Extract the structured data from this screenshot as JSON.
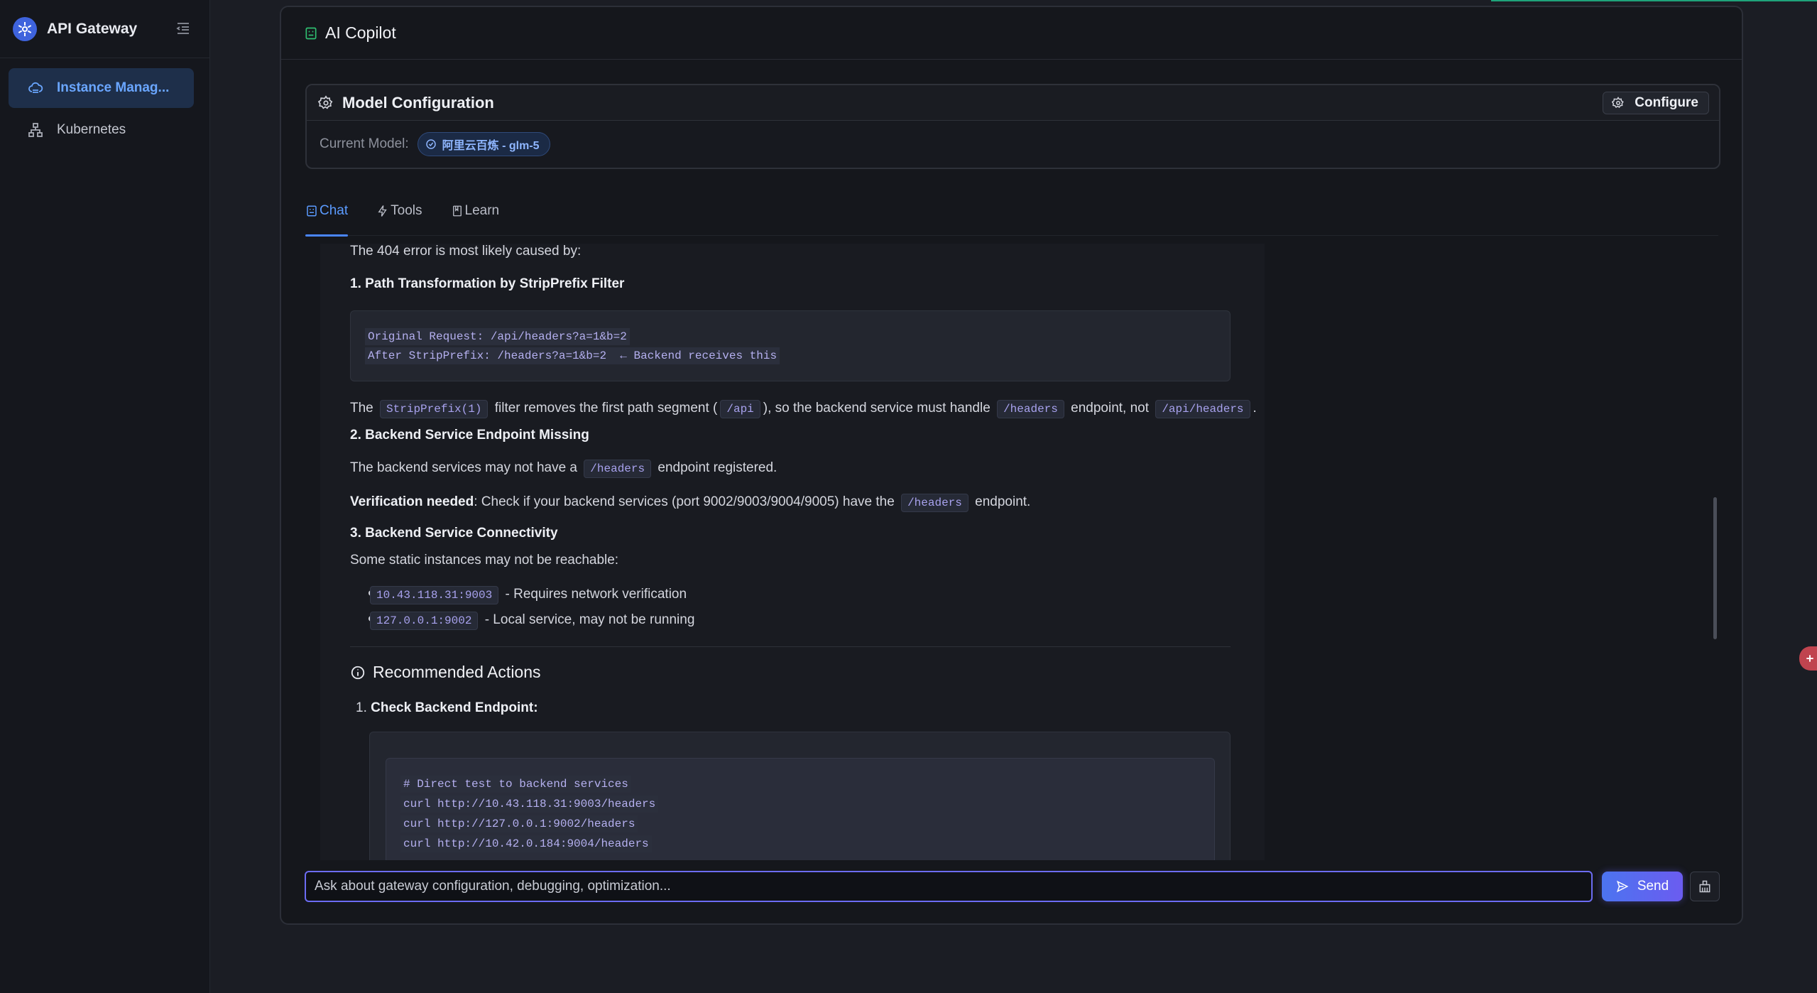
{
  "app": {
    "name": "API Gateway"
  },
  "sidebar": {
    "items": [
      {
        "label": "Instance Manag...",
        "icon": "cloud-gateway-icon",
        "active": true
      },
      {
        "label": "Kubernetes",
        "icon": "cluster-icon",
        "active": false
      }
    ]
  },
  "panel": {
    "title": "AI Copilot",
    "model_config": {
      "title": "Model Configuration",
      "configure_label": "Configure",
      "current_model_label": "Current Model:",
      "current_model_value": "阿里云百炼 - glm-5"
    },
    "tabs": [
      {
        "label": "Chat",
        "icon": "chat-icon",
        "active": true
      },
      {
        "label": "Tools",
        "icon": "lightning-icon",
        "active": false
      },
      {
        "label": "Learn",
        "icon": "book-icon",
        "active": false
      }
    ]
  },
  "message": {
    "intro": "The 404 error is most likely caused by:",
    "h1": "1. Path Transformation by StripPrefix Filter",
    "code1": [
      "Original Request: /api/headers?a=1&b=2",
      "After StripPrefix: /headers?a=1&b=2  ← Backend receives this"
    ],
    "p1_a": "The",
    "p1_code1": "StripPrefix(1)",
    "p1_b": "filter removes the first path segment (",
    "p1_code2": "/api",
    "p1_c": "), so the backend service must handle",
    "p1_code3": "/headers",
    "p1_d": "endpoint, not",
    "p1_code4": "/api/headers",
    "p1_e": ".",
    "h2": "2. Backend Service Endpoint Missing",
    "p2_a": "The backend services may not have a",
    "p2_code": "/headers",
    "p2_b": "endpoint registered.",
    "p3_bold": "Verification needed",
    "p3_a": ": Check if your backend services (port 9002/9003/9004/9005) have the",
    "p3_code": "/headers",
    "p3_b": "endpoint.",
    "h3": "3. Backend Service Connectivity",
    "p4": "Some static instances may not be reachable:",
    "li1_code": "10.43.118.31:9003",
    "li1_text": "- Requires network verification",
    "li2_code": "127.0.0.1:9002",
    "li2_text": "- Local service, may not be running",
    "section_title": "Recommended Actions",
    "step1_num": "1.",
    "step1": "Check Backend Endpoint:",
    "code2": [
      "# Direct test to backend services",
      "curl http://10.43.118.31:9003/headers",
      "curl http://127.0.0.1:9002/headers",
      "curl http://10.42.0.184:9004/headers"
    ]
  },
  "input": {
    "placeholder": "Ask about gateway configuration, debugging, optimization...",
    "send_label": "Send"
  },
  "colors": {
    "accent": "#4a86ff",
    "send": "#5b6cf0",
    "code_text": "#a8a2ee"
  }
}
